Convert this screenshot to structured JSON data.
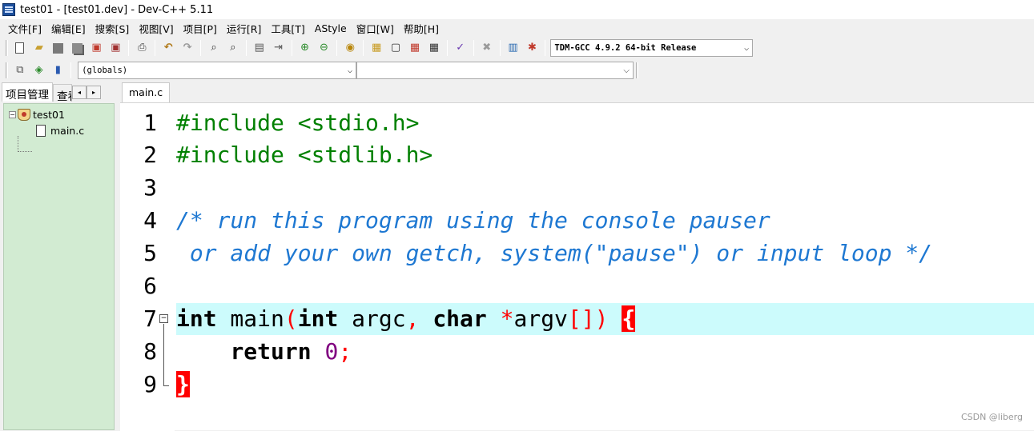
{
  "window": {
    "title": "test01 - [test01.dev] - Dev-C++ 5.11"
  },
  "menu": [
    "文件[F]",
    "编辑[E]",
    "搜索[S]",
    "视图[V]",
    "项目[P]",
    "运行[R]",
    "工具[T]",
    "AStyle",
    "窗口[W]",
    "帮助[H]"
  ],
  "toolbar": {
    "compiler_select": "TDM-GCC 4.9.2 64-bit Release",
    "scope_select": "(globals)",
    "members_select": ""
  },
  "icons": {
    "new": "new-file-icon",
    "open": "open-folder-icon",
    "save": "save-icon",
    "save_all": "save-all-icon",
    "close": "close-file-icon",
    "print": "print-icon",
    "undo": "undo-icon",
    "redo": "redo-icon",
    "find": "find-icon",
    "replace": "replace-icon",
    "goto": "goto-line-icon",
    "indent": "indent-icon",
    "add_project": "add-to-project-icon",
    "remove_project": "remove-from-project-icon",
    "class": "class-browser-icon",
    "compile": "compile-icon",
    "run": "run-icon",
    "compile_run": "compile-run-icon",
    "rebuild": "rebuild-all-icon",
    "check": "syntax-check-icon",
    "stop": "stop-icon",
    "chart": "chart-icon",
    "debug": "debug-icon"
  },
  "left_panel": {
    "tabs": [
      "项目管理",
      "查看类"
    ],
    "project": "test01",
    "files": [
      "main.c"
    ]
  },
  "editor": {
    "tab": "main.c",
    "line_numbers": [
      "1",
      "2",
      "3",
      "4",
      "5",
      "6",
      "7",
      "8",
      "9"
    ],
    "code": {
      "line1": "#include <stdio.h>",
      "line2": "#include <stdlib.h>",
      "line4": "/* run this program using the console pauser",
      "line5": " or add your own getch, system(\"pause\") or input loop */",
      "line7_kw1": "int",
      "line7_main": " main",
      "line7_paren_open": "(",
      "line7_kw2": "int",
      "line7_argc": " argc",
      "line7_comma": ",",
      "line7_sp": " ",
      "line7_kw3": "char",
      "line7_sp2": " ",
      "line7_star": "*",
      "line7_argv": "argv",
      "line7_brackets": "[]",
      "line7_paren_close": ")",
      "line7_sp3": " ",
      "line7_brace": "{",
      "line8_indent": "    ",
      "line8_kw": "return",
      "line8_sp": " ",
      "line8_num": "0",
      "line8_semi": ";",
      "line9_brace": "}"
    }
  },
  "watermark": "CSDN @liberg",
  "colors": {
    "preprocessor": "#008000",
    "comment": "#1e78d2",
    "symbol": "#ff0000",
    "number": "#800080",
    "current_line": "#ccfbfc",
    "project_panel": "#d2ebd2"
  }
}
